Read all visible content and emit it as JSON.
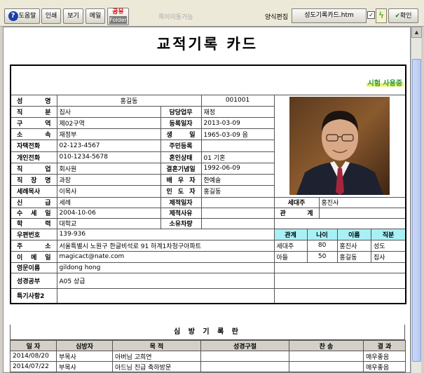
{
  "toolbar": {
    "help_label": "도움말",
    "print_label": "인쇄",
    "view_label": "보기",
    "mail_label": "메일",
    "share_label": "공유",
    "folder_label": "Folder",
    "page_move_label": "쪽이이동가능",
    "form_edit_label": "양식편집",
    "form_file": "성도기록카드.htm",
    "ok_label": "확인"
  },
  "card": {
    "title": "교적기록 카드",
    "stamp": "시험 사용중"
  },
  "labels": {
    "name": "성 명",
    "position": "직 분",
    "district": "구 역",
    "affiliation": "소 속",
    "home_phone": "자택전화",
    "mobile": "개인전화",
    "job": "직 업",
    "workplace": "직 장 명",
    "parish_pastor": "세례목사",
    "faith": "신 급",
    "baptism_date": "수 세 일",
    "education": "학 력",
    "zipcode": "우편번호",
    "address": "주 소",
    "email": "이 메 일",
    "english_name": "영문이름",
    "bible_study": "성경공부",
    "notes2": "특기사항2",
    "duty": "담당업무",
    "reg_date": "등록일자",
    "birthday": "생 일",
    "resident_no": "주민등록",
    "marital": "혼인상태",
    "wedding_anniv": "결혼기념일",
    "spouse": "배 우 자",
    "guide": "인 도 자",
    "transfer_date": "제적일자",
    "transfer_reason": "제적사유",
    "vehicle": "소유차량",
    "household_head": "세대주",
    "relation": "관 계"
  },
  "member": {
    "name": "홍길동",
    "id": "001001",
    "position": "집사",
    "district": "제02구역",
    "affiliation": "재정부",
    "home_phone": "02-123-4567",
    "mobile": "010-1234-5678",
    "job": "회사원",
    "workplace": "과장",
    "parish_pastor": "이목사",
    "faith": "세례",
    "baptism_date": "2004-10-06",
    "education": "대학교",
    "zipcode": "139-936",
    "address": "서울특별시 노원구 한글비석로 91 하계1차청구아파트",
    "email": "magicact@nate.com",
    "english_name": "gildong hong",
    "bible_study": "A05 상급",
    "duty": "재정",
    "reg_date": "2013-03-09",
    "birthday": "1965-03-09 음",
    "marital": "01 기혼",
    "wedding_anniv": "1992-06-09",
    "spouse": "한예슬",
    "guide": "홍길동",
    "household_head": "홍진사"
  },
  "family": {
    "headers": [
      "관계",
      "나이",
      "이름",
      "직분"
    ],
    "rows": [
      [
        "세대주",
        "80",
        "홍진사",
        "성도"
      ],
      [
        "아들",
        "50",
        "홍길동",
        "집사"
      ]
    ]
  },
  "visit": {
    "title": "심 방 기 록 란",
    "headers": [
      "일 자",
      "심방자",
      "목 적",
      "성경구절",
      "찬 송",
      "결 과"
    ],
    "rows": [
      [
        "2014/08/20",
        "부목사",
        "아버님 고희연",
        "",
        "",
        "매우좋음"
      ],
      [
        "2014/07/22",
        "부목사",
        "아드님 진급 축하방문",
        "",
        "",
        "매우좋음"
      ]
    ]
  },
  "colors": {
    "family_header_bg": "#a8f0f4",
    "stamp_text": "#2a9a2a",
    "stamp_highlight": "#f2ef6a",
    "share_text": "#d00000"
  }
}
